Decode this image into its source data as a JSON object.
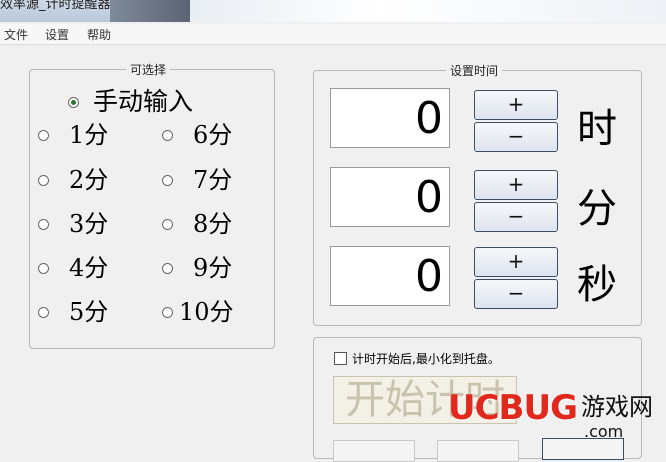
{
  "window": {
    "title": "效率源_计时提醒器"
  },
  "menu": {
    "items": [
      "文件",
      "设置",
      "帮助"
    ]
  },
  "options_group": {
    "title": "可选择",
    "manual_label": "手动输入",
    "left_column": [
      "1分",
      "2分",
      "3分",
      "4分",
      "5分"
    ],
    "right_column": [
      "6分",
      "7分",
      "8分",
      "9分",
      "10分"
    ],
    "selected": "手动输入"
  },
  "time_group": {
    "title": "设置时间",
    "rows": [
      {
        "value": "0",
        "plus": "+",
        "minus": "−",
        "unit": "时"
      },
      {
        "value": "0",
        "plus": "+",
        "minus": "−",
        "unit": "分"
      },
      {
        "value": "0",
        "plus": "+",
        "minus": "−",
        "unit": "秒"
      }
    ]
  },
  "bottom_group": {
    "minimize_label": "计时开始后,最小化到托盘。",
    "minimize_checked": false,
    "start_label": "开始计时"
  },
  "watermark": {
    "brand": "UCBUG",
    "cn": "游戏网",
    "domain": ".com"
  }
}
